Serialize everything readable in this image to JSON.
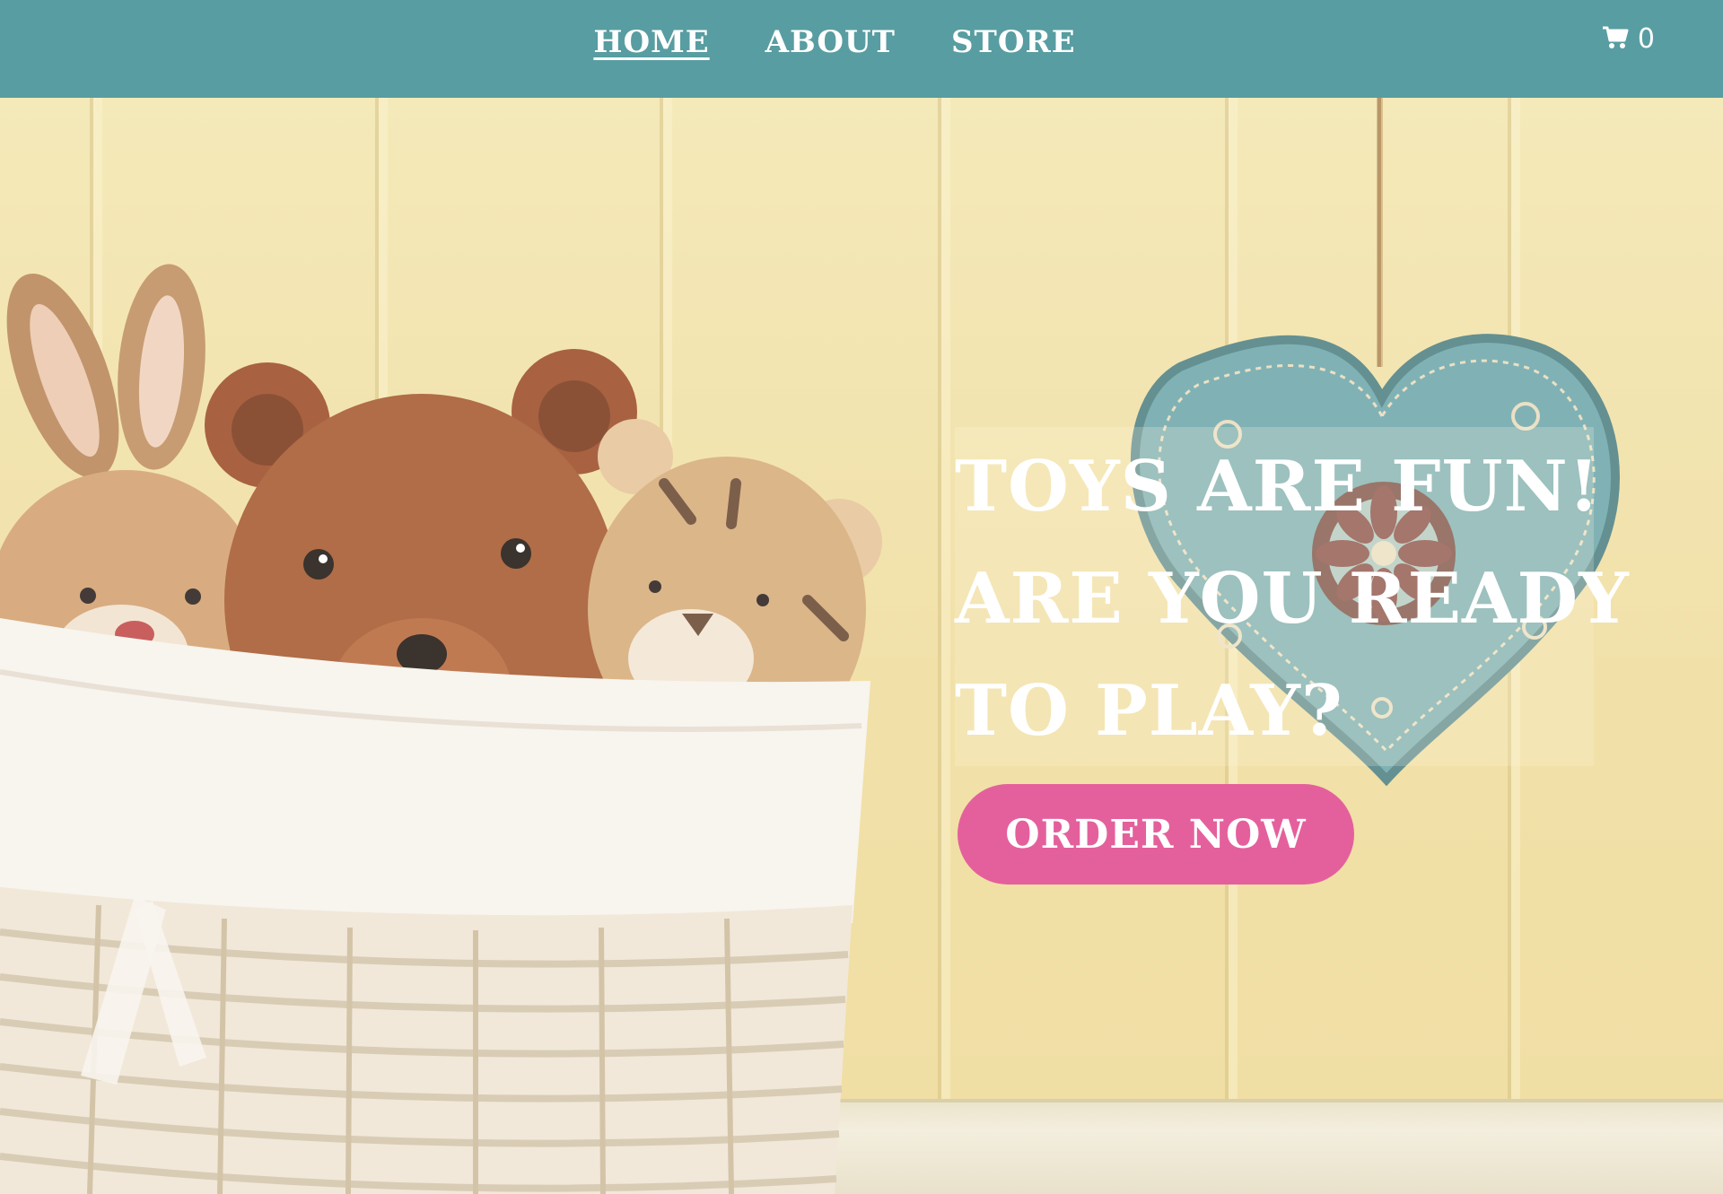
{
  "nav": {
    "items": [
      {
        "label": "HOME",
        "active": true
      },
      {
        "label": "ABOUT",
        "active": false
      },
      {
        "label": "STORE",
        "active": false
      }
    ],
    "cart": {
      "icon": "cart-icon",
      "count": "0"
    }
  },
  "hero": {
    "headline_lines": [
      "TOYS ARE FUN!",
      "ARE YOU READY",
      "TO PLAY?"
    ],
    "cta_label": "ORDER NOW"
  },
  "colors": {
    "navbar": "#589da1",
    "cta": "#e4609c",
    "text": "#ffffff",
    "wall": "#f0de9f"
  }
}
